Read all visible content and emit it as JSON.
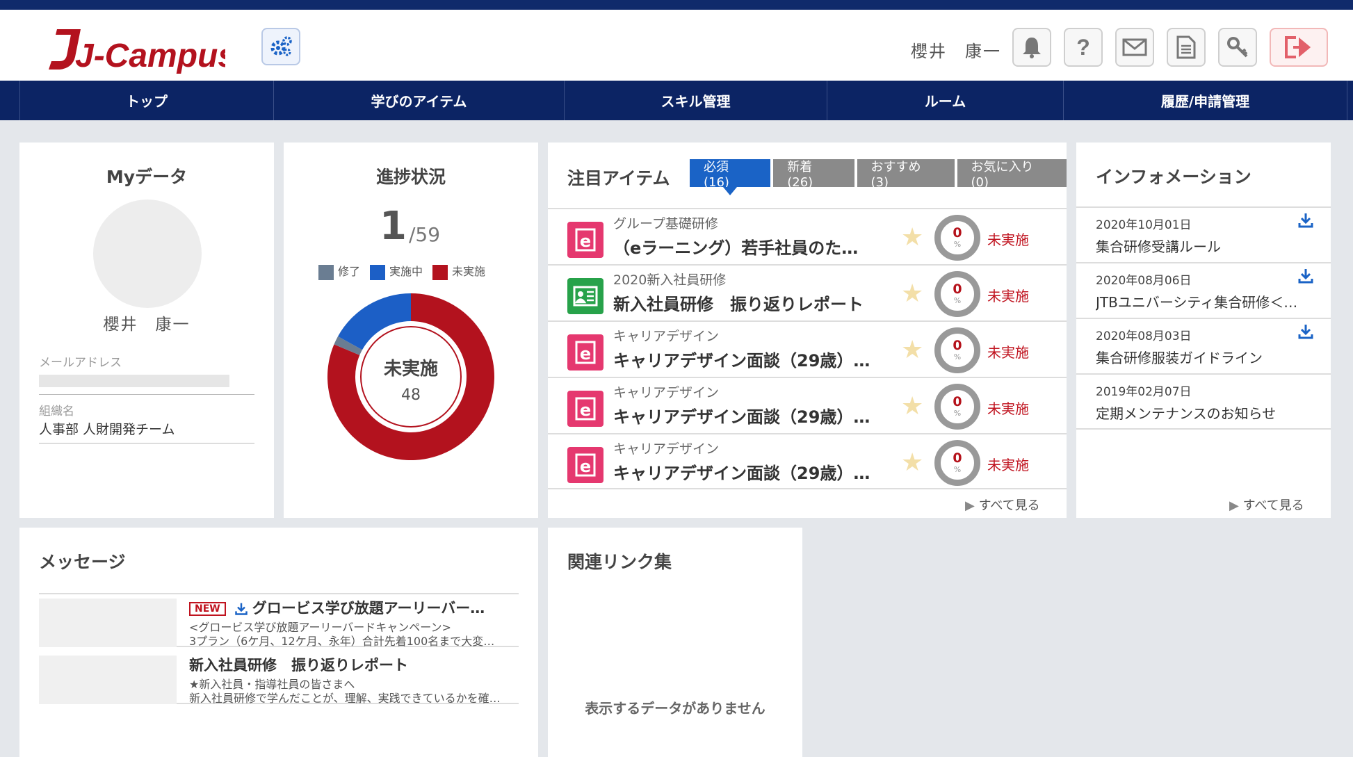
{
  "header": {
    "logo_text": "J-Campus",
    "user_name": "櫻井　康一",
    "icons": [
      "bell-icon",
      "help-icon",
      "mail-icon",
      "document-icon",
      "key-icon",
      "logout-icon"
    ]
  },
  "nav": {
    "items": [
      {
        "label": "トップ"
      },
      {
        "label": "学びのアイテム"
      },
      {
        "label": "スキル管理"
      },
      {
        "label": "ルーム"
      },
      {
        "label": "履歴/申請管理"
      }
    ]
  },
  "mydata": {
    "title": "Myデータ",
    "name": "櫻井　康一",
    "email_label": "メールアドレス",
    "org_label": "組織名",
    "org_value": "人事部 人財開発チーム"
  },
  "progress": {
    "title": "進捗状況",
    "completed": "1",
    "total": "/59",
    "legend": [
      {
        "label": "修了",
        "color": "#6a7d92"
      },
      {
        "label": "実施中",
        "color": "#1c5fc6"
      },
      {
        "label": "未実施",
        "color": "#b3121e"
      }
    ],
    "center_label": "未実施",
    "center_value": "48",
    "segments": {
      "not_started": 48,
      "in_progress": 10,
      "completed": 1
    }
  },
  "featured": {
    "title": "注目アイテム",
    "tabs": [
      {
        "label": "必須 (16)"
      },
      {
        "label": "新着 (26)"
      },
      {
        "label": "おすすめ (3)"
      },
      {
        "label": "お気に入り (0)"
      }
    ],
    "items": [
      {
        "category": "グループ基礎研修",
        "name": "（eラーニング）若手社員のた…",
        "percent": "0",
        "status": "未実施",
        "type": "elearning"
      },
      {
        "category": "2020新入社員研修",
        "name": "新入社員研修　振り返りレポート",
        "percent": "0",
        "status": "未実施",
        "type": "report"
      },
      {
        "category": "キャリアデザイン",
        "name": "キャリアデザイン面談（29歳）…",
        "percent": "0",
        "status": "未実施",
        "type": "elearning"
      },
      {
        "category": "キャリアデザイン",
        "name": "キャリアデザイン面談（29歳）…",
        "percent": "0",
        "status": "未実施",
        "type": "elearning"
      },
      {
        "category": "キャリアデザイン",
        "name": "キャリアデザイン面談（29歳）…",
        "percent": "0",
        "status": "未実施",
        "type": "elearning"
      }
    ],
    "percent_sign": "%",
    "see_all": "すべて見る"
  },
  "info": {
    "title": "インフォメーション",
    "items": [
      {
        "date": "2020年10月01日",
        "title": "集合研修受講ルール",
        "download": true
      },
      {
        "date": "2020年08月06日",
        "title": "JTBユニバーシティ集合研修＜…",
        "download": true
      },
      {
        "date": "2020年08月03日",
        "title": "集合研修服装ガイドライン",
        "download": true
      },
      {
        "date": "2019年02月07日",
        "title": "定期メンテナンスのお知らせ",
        "download": false
      }
    ],
    "see_all": "すべて見る"
  },
  "messages": {
    "title": "メッセージ",
    "new_badge": "NEW",
    "items": [
      {
        "title": "グロービス学び放題アーリーバー…",
        "line1": "<グロービス学び放題アーリーバードキャンペーン>",
        "line2": "3プラン（6ケ月、12ケ月、永年）合計先着100名まで大変…"
      },
      {
        "title": "新入社員研修　振り返りレポート",
        "line1": "★新入社員・指導社員の皆さまへ",
        "line2": "新入社員研修で学んだことが、理解、実践できているかを確…"
      }
    ]
  },
  "links": {
    "title": "関連リンク集",
    "empty": "表示するデータがありません"
  }
}
